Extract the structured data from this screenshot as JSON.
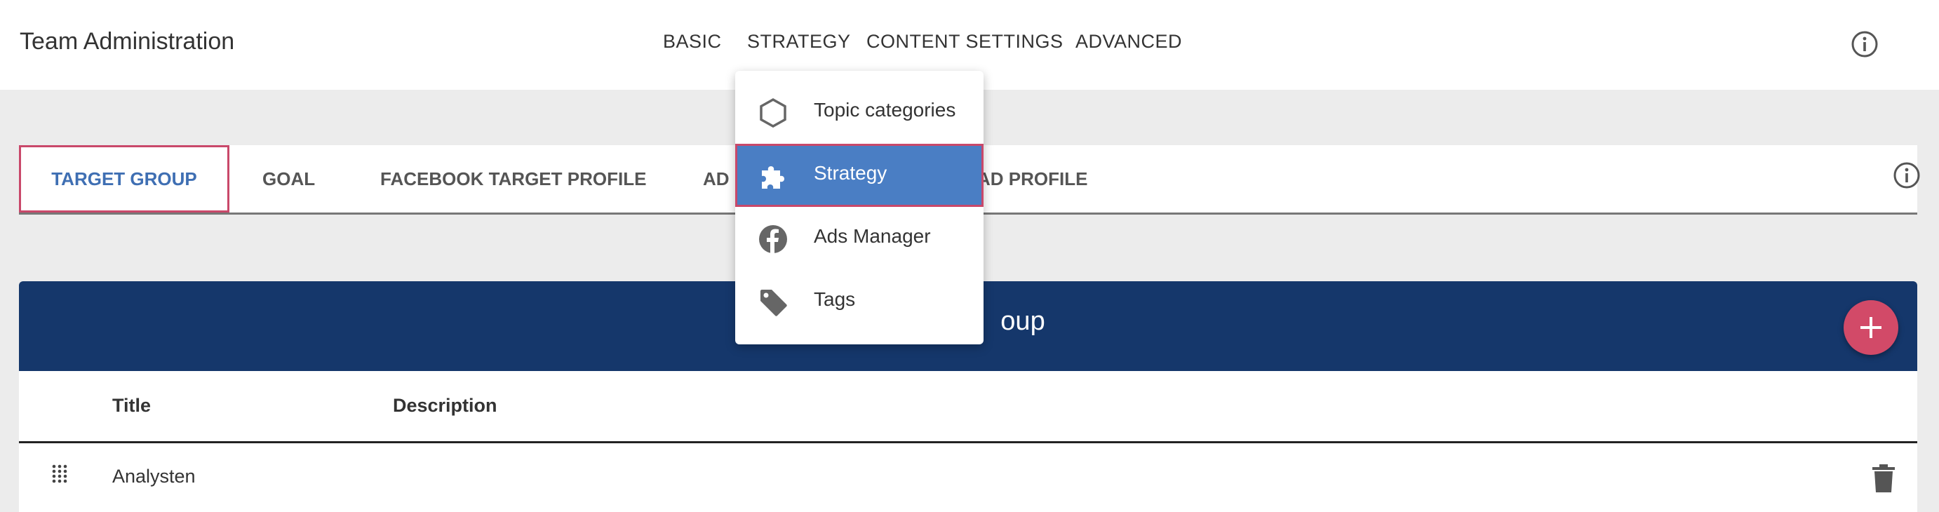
{
  "app": {
    "title": "Team Administration"
  },
  "topnav": {
    "items": [
      {
        "label": "BASIC"
      },
      {
        "label": "STRATEGY"
      },
      {
        "label": "CONTENT SETTINGS"
      },
      {
        "label": "ADVANCED"
      }
    ]
  },
  "icons": {
    "info": "info-icon",
    "hexagon": "hexagon-icon",
    "puzzle": "puzzle-icon",
    "facebook": "facebook-icon",
    "tag": "tag-icon",
    "add": "plus-icon",
    "drag": "drag-handle-icon",
    "delete": "trash-icon"
  },
  "subtabs": {
    "items": [
      {
        "label": "TARGET GROUP",
        "active": true
      },
      {
        "label": "GOAL"
      },
      {
        "label": "FACEBOOK TARGET PROFILE"
      },
      {
        "label": "AD"
      },
      {
        "label": "AD PROFILE"
      }
    ]
  },
  "dropdown": {
    "items": [
      {
        "label": "Topic categories",
        "icon": "hexagon-icon"
      },
      {
        "label": "Strategy",
        "icon": "puzzle-icon",
        "selected": true
      },
      {
        "label": "Ads Manager",
        "icon": "facebook-icon"
      },
      {
        "label": "Tags",
        "icon": "tag-icon"
      }
    ]
  },
  "panel": {
    "title_visible": "oup"
  },
  "table": {
    "columns": [
      "Title",
      "Description"
    ],
    "rows": [
      {
        "title": "Analysten",
        "description": ""
      }
    ]
  },
  "colors": {
    "accent": "#3f6fb3",
    "panel_header": "#15376b",
    "fab": "#d24a68",
    "menu_selected": "#4a7ec4",
    "highlight_border": "#c9486a"
  }
}
